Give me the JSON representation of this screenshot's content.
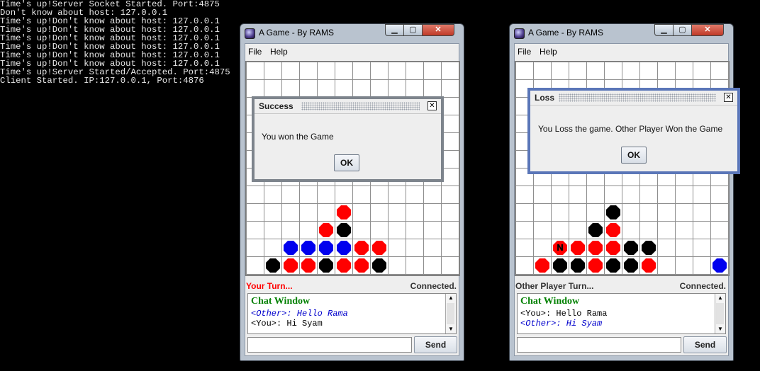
{
  "console": {
    "lines": [
      "Time's up!Server Socket Started. Port:4875",
      "Don't know about host: 127.0.0.1",
      "Time's up!Don't know about host: 127.0.0.1",
      "Time's up!Don't know about host: 127.0.0.1",
      "Time's up!Don't know about host: 127.0.0.1",
      "Time's up!Don't know about host: 127.0.0.1",
      "Time's up!Don't know about host: 127.0.0.1",
      "Time's up!Don't know about host: 127.0.0.1",
      "Time's up!Server Started/Accepted. Port:4875",
      "Client Started. IP:127.0.0.1, Port:4876"
    ]
  },
  "windows": [
    {
      "title": "A Game - By RAMS",
      "menu": {
        "file": "File",
        "help": "Help"
      },
      "status": {
        "turn": "Your Turn...",
        "turn_color": "#ff0000",
        "connection": "Connected."
      },
      "chat": {
        "title": "Chat Window",
        "lines": [
          {
            "text": "<Other>: Hello Rama",
            "kind": "other"
          },
          {
            "text": "<You>: Hi Syam",
            "kind": "you"
          }
        ],
        "input_value": "",
        "send_label": "Send"
      },
      "board": {
        "rows": 12,
        "cols": 12,
        "discs": [
          {
            "row": 8,
            "col": 5,
            "color": "red"
          },
          {
            "row": 9,
            "col": 4,
            "color": "red"
          },
          {
            "row": 9,
            "col": 5,
            "color": "black"
          },
          {
            "row": 10,
            "col": 2,
            "color": "blue"
          },
          {
            "row": 10,
            "col": 3,
            "color": "blue"
          },
          {
            "row": 10,
            "col": 4,
            "color": "blue"
          },
          {
            "row": 10,
            "col": 5,
            "color": "blue"
          },
          {
            "row": 10,
            "col": 6,
            "color": "red"
          },
          {
            "row": 10,
            "col": 7,
            "color": "red"
          },
          {
            "row": 11,
            "col": 1,
            "color": "black"
          },
          {
            "row": 11,
            "col": 2,
            "color": "red"
          },
          {
            "row": 11,
            "col": 3,
            "color": "red"
          },
          {
            "row": 11,
            "col": 4,
            "color": "black"
          },
          {
            "row": 11,
            "col": 5,
            "color": "red"
          },
          {
            "row": 11,
            "col": 6,
            "color": "red"
          },
          {
            "row": 11,
            "col": 7,
            "color": "black"
          }
        ]
      }
    },
    {
      "title": "A Game - By RAMS",
      "menu": {
        "file": "File",
        "help": "Help"
      },
      "status": {
        "turn": "Other Player Turn...",
        "turn_color": "#333333",
        "connection": "Connected."
      },
      "chat": {
        "title": "Chat Window",
        "lines": [
          {
            "text": "<You>: Hello Rama",
            "kind": "you"
          },
          {
            "text": "<Other>: Hi Syam",
            "kind": "other"
          }
        ],
        "input_value": "",
        "send_label": "Send"
      },
      "board": {
        "rows": 12,
        "cols": 12,
        "discs": [
          {
            "row": 8,
            "col": 5,
            "color": "black"
          },
          {
            "row": 9,
            "col": 4,
            "color": "black"
          },
          {
            "row": 9,
            "col": 5,
            "color": "red"
          },
          {
            "row": 10,
            "col": 2,
            "color": "red",
            "letter": "N"
          },
          {
            "row": 10,
            "col": 3,
            "color": "red"
          },
          {
            "row": 10,
            "col": 4,
            "color": "red"
          },
          {
            "row": 10,
            "col": 5,
            "color": "red"
          },
          {
            "row": 10,
            "col": 6,
            "color": "black"
          },
          {
            "row": 10,
            "col": 7,
            "color": "black"
          },
          {
            "row": 11,
            "col": 1,
            "color": "red"
          },
          {
            "row": 11,
            "col": 2,
            "color": "black"
          },
          {
            "row": 11,
            "col": 3,
            "color": "black"
          },
          {
            "row": 11,
            "col": 4,
            "color": "red"
          },
          {
            "row": 11,
            "col": 5,
            "color": "black"
          },
          {
            "row": 11,
            "col": 6,
            "color": "black"
          },
          {
            "row": 11,
            "col": 7,
            "color": "red"
          },
          {
            "row": 11,
            "col": 11,
            "color": "blue"
          }
        ]
      }
    }
  ],
  "dialogs": {
    "success": {
      "title": "Success",
      "message": "You won the Game",
      "ok_label": "OK"
    },
    "loss": {
      "title": "Loss",
      "message": "You Loss the game. Other Player Won the Game",
      "ok_label": "OK"
    }
  },
  "icons": {
    "close": "close-icon",
    "minimize": "minimize-icon",
    "maximize": "maximize-icon"
  }
}
